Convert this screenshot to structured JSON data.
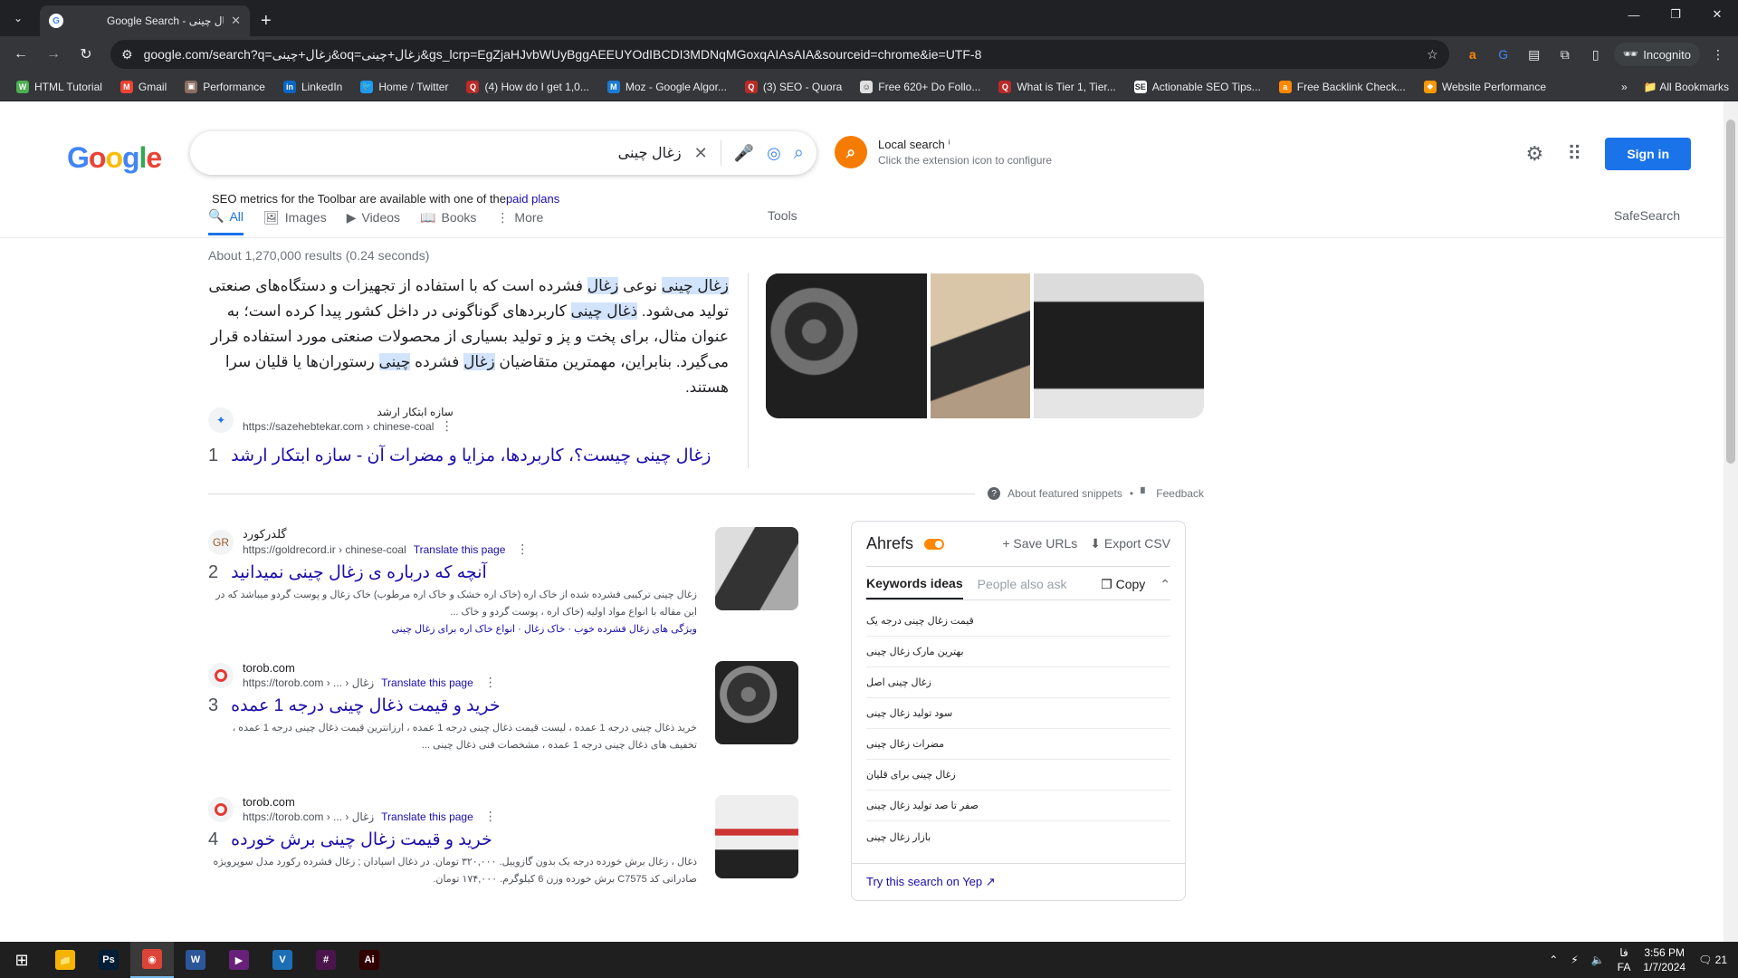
{
  "browser": {
    "tab_title": "Google Search - زغال چینی",
    "url": "google.com/search?q=زغال+چینی&oq=زغال+چینی&gs_lcrp=EgZjaHJvbWUyBggAEEUYOdIBCDI3MDNqMGoxqAIAsAIA&sourceid=chrome&ie=UTF-8",
    "incognito_label": "Incognito"
  },
  "bookmarks": [
    {
      "label": "HTML Tutorial",
      "color": "#4caf50",
      "glyph": "W"
    },
    {
      "label": "Gmail",
      "color": "#ea4335",
      "glyph": "M"
    },
    {
      "label": "Performance",
      "color": "#8d6e63",
      "glyph": "▣"
    },
    {
      "label": "LinkedIn",
      "color": "#0a66c2",
      "glyph": "in"
    },
    {
      "label": "Home / Twitter",
      "color": "#1d9bf0",
      "glyph": "🐦"
    },
    {
      "label": "(4) How do I get 1,0...",
      "color": "#b92b27",
      "glyph": "Q"
    },
    {
      "label": "Moz - Google Algor...",
      "color": "#1b7ad3",
      "glyph": "M"
    },
    {
      "label": "(3) SEO - Quora",
      "color": "#b92b27",
      "glyph": "Q"
    },
    {
      "label": "Free 620+ Do Follo...",
      "color": "#e0e0e0",
      "glyph": "☺"
    },
    {
      "label": "What is Tier 1, Tier...",
      "color": "#b92b27",
      "glyph": "Q"
    },
    {
      "label": "Actionable SEO Tips...",
      "color": "#ffffff",
      "glyph": "SE"
    },
    {
      "label": "Free Backlink Check...",
      "color": "#ff8800",
      "glyph": "a"
    },
    {
      "label": "Website Performance",
      "color": "#ff9800",
      "glyph": "◆"
    }
  ],
  "bookmarks_more": "All Bookmarks",
  "search": {
    "query": "زغال چینی",
    "seo_note_prefix": "SEO metrics for the Toolbar are available with one of the",
    "seo_note_link": "paid plans",
    "local_title": "Local search",
    "local_sub": "Click the extension icon to configure",
    "signin": "Sign in",
    "tabs": [
      {
        "label": "All",
        "icon": "search-icon",
        "glyph": "🔍"
      },
      {
        "label": "Images",
        "icon": "image-icon",
        "glyph": "🖼"
      },
      {
        "label": "Videos",
        "icon": "video-icon",
        "glyph": "▶"
      },
      {
        "label": "Books",
        "icon": "book-icon",
        "glyph": "📖"
      },
      {
        "label": "More",
        "icon": "more-icon",
        "glyph": "⋮"
      }
    ],
    "tools": "Tools",
    "safesearch": "SafeSearch",
    "stats": "About 1,270,000 results (0.24 seconds)"
  },
  "featured": {
    "text_html": "<mark>زغال چینی</mark> نوعی <mark>زغال</mark> فشرده است که با استفاده از تجهیزات و دستگاه‌های صنعتی تولید می‌شود. <mark>ذغال چینی</mark> کاربردهای گوناگونی در داخل کشور پیدا کرده است؛ به عنوان مثال، برای پخت و پز و تولید بسیاری از محصولات صنعتی مورد استفاده قرار می‌گیرد. بنابراین، مهمترین متقاضیان <mark>زغال</mark> فشرده <mark>چینی</mark> رستوران‌ها یا قلیان سرا هستند.",
    "site_name": "سازه ابتکار ارشد",
    "site_url": "https://sazehebtekar.com › chinese-coal",
    "rank": "1",
    "title": "زغال چینی چیست؟، کاربردها، مزایا و مضرات آن - سازه ابتکار ارشد",
    "about": "About featured snippets",
    "feedback": "Feedback"
  },
  "results": [
    {
      "rank": "2",
      "site": "گلدرکورد",
      "url": "https://goldrecord.ir › chinese-coal",
      "translate": "Translate this page",
      "title": "آنچه که درباره ی زغال چینی نمیدانید",
      "desc": "زغال چینی ترکیبی فشرده شده از خاک اره (خاک اره خشک و خاک اره مرطوب) خاک زغال و پوست گردو میباشد که در این مقاله با انواع مواد اولیه (خاک اره ، پوست گردو و خاک ...",
      "sublinks": "ویژگی های زغال فشرده خوب · خاک زغال · انواع خاک اره برای زغال چینی"
    },
    {
      "rank": "3",
      "site": "torob.com",
      "url": "https://torob.com › ... › زغال",
      "translate": "Translate this page",
      "title": "خرید و قیمت ذغال چینی درجه 1 عمده",
      "desc": "خرید ذغال چینی درجه 1 عمده ، لیست قیمت ذغال چینی درجه 1 عمده ، ارزانترین قیمت ذغال چینی درجه 1 عمده ، تخفیف های ذغال چینی درجه 1 عمده ، مشخصات فنی ذغال چینی ...",
      "sublinks": ""
    },
    {
      "rank": "4",
      "site": "torob.com",
      "url": "https://torob.com › ... › زغال",
      "translate": "Translate this page",
      "title": "خرید و قیمت زغال چینی برش خورده",
      "desc": "ذغال ، زغال برش خورده درجه یک بدون گازوییل. ۳۲۰,۰۰۰ تومان. در ذغال اسپادان ; زغال فشرده رکورد مدل سوپرویژه صادراتی کد C7575 برش خورده وزن 6 کیلوگرم. ۱۷۴,۰۰۰ تومان.",
      "sublinks": ""
    }
  ],
  "ahrefs": {
    "logo": "Ahrefs",
    "save": "+ Save URLs",
    "export": "Export CSV",
    "tab_active": "Keywords ideas",
    "tab_inactive": "People also ask",
    "copy": "Copy",
    "items": [
      "قیمت زغال چینی درجه یک",
      "بهترین مارک زغال چینی",
      "زغال چینی اصل",
      "سود تولید زغال چینی",
      "مضرات زغال چینی",
      "زغال چینی برای قلیان",
      "صفر تا صد تولید زغال چینی",
      "بازار زغال چینی"
    ],
    "footer": "Try this search on Yep ↗"
  },
  "taskbar": {
    "time": "3:56 PM",
    "date": "1/7/2024",
    "lang": "FA",
    "lang_top": "فا",
    "notif": "21",
    "apps": [
      {
        "name": "file-explorer-app",
        "glyph": "📁",
        "color": "#f4b400"
      },
      {
        "name": "photoshop-app",
        "glyph": "Ps",
        "color": "#001e36"
      },
      {
        "name": "chrome-app",
        "glyph": "◉",
        "color": "#db4437"
      },
      {
        "name": "word-app",
        "glyph": "W",
        "color": "#2b579a"
      },
      {
        "name": "visual-studio-app",
        "glyph": "▶",
        "color": "#68217a"
      },
      {
        "name": "viber-app",
        "glyph": "V",
        "color": "#1c6fb5"
      },
      {
        "name": "slack-app",
        "glyph": "#",
        "color": "#4a154b"
      },
      {
        "name": "illustrator-app",
        "glyph": "Ai",
        "color": "#330000"
      }
    ]
  }
}
